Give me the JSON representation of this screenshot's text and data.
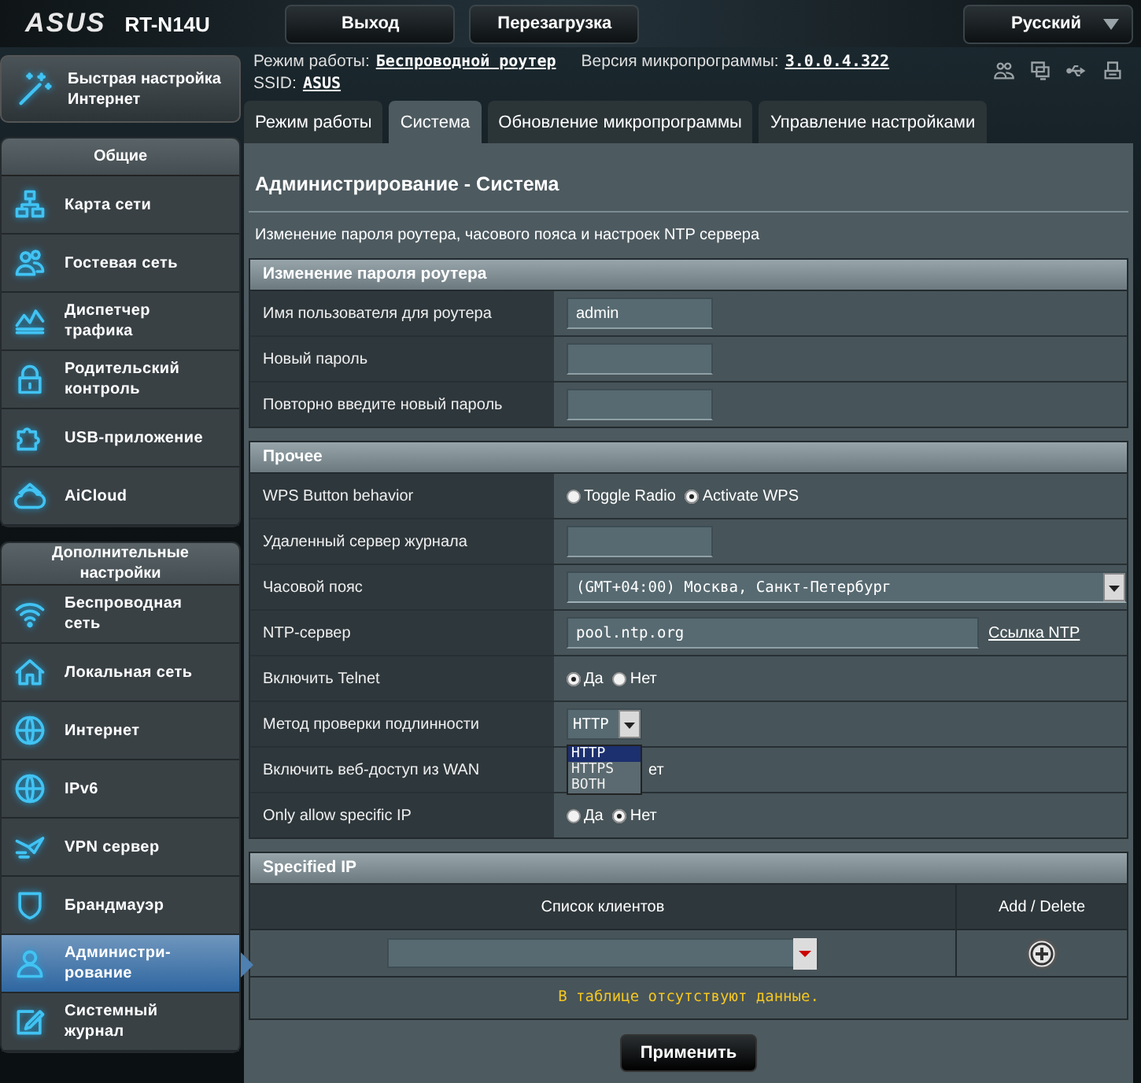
{
  "header": {
    "logo": "ASUS",
    "model": "RT-N14U",
    "buttons": [
      "Выход",
      "Перезагрузка"
    ],
    "language": "Русский"
  },
  "info": {
    "mode_label": "Режим работы:",
    "mode": "Беспроводной роутер",
    "firmware_label": "Версия микропрограммы:",
    "firmware": "3.0.0.4.322",
    "ssid_label": "SSID:",
    "ssid": "ASUS"
  },
  "sidebar": {
    "quick_setup": "Быстрая настройка\nИнтернет",
    "groups": [
      {
        "title": "Общие",
        "items": [
          {
            "label": "Карта сети",
            "selected": false
          },
          {
            "label": "Гостевая сеть",
            "selected": false
          },
          {
            "label": "Диспетчер\nтрафика",
            "selected": false
          },
          {
            "label": "Родительский\nконтроль",
            "selected": false
          },
          {
            "label": "USB-приложение",
            "selected": false
          },
          {
            "label": "AiCloud",
            "selected": false
          }
        ]
      },
      {
        "title": "Дополнительные\nнастройки",
        "items": [
          {
            "label": "Беспроводная\nсеть",
            "selected": false
          },
          {
            "label": "Локальная сеть",
            "selected": false
          },
          {
            "label": "Интернет",
            "selected": false
          },
          {
            "label": "IPv6",
            "selected": false
          },
          {
            "label": "VPN сервер",
            "selected": false
          },
          {
            "label": "Брандмауэр",
            "selected": false
          },
          {
            "label": "Администри-\nрование",
            "selected": true
          },
          {
            "label": "Системный\nжурнал",
            "selected": false
          }
        ]
      }
    ]
  },
  "tabs": [
    {
      "label": "Режим работы",
      "selected": false
    },
    {
      "label": "Система",
      "selected": true
    },
    {
      "label": "Обновление микропрограммы",
      "selected": false
    },
    {
      "label": "Управление настройками",
      "selected": false
    }
  ],
  "page": {
    "title": "Администрирование - Система",
    "description": "Изменение пароля роутера, часового пояса и настроек NTP сервера"
  },
  "sections": [
    {
      "title": "Изменение пароля роутера",
      "rows": [
        {
          "label": "Имя пользователя для роутера",
          "kind": "input",
          "value": "admin"
        },
        {
          "label": "Новый пароль",
          "kind": "input"
        },
        {
          "label": "Повторно введите новый пароль",
          "kind": "input"
        }
      ]
    },
    {
      "title": "Прочее",
      "rows": [
        {
          "label": "WPS Button behavior",
          "kind": "radio",
          "options": [
            {
              "label": "Toggle Radio",
              "selected": false
            },
            {
              "label": "Activate WPS",
              "selected": true
            }
          ]
        },
        {
          "label": "Удаленный сервер журнала",
          "kind": "input"
        },
        {
          "label": "Часовой пояс",
          "kind": "select",
          "value": "(GMT+04:00) Москва, Санкт-Петербург"
        },
        {
          "label": "NTP-сервер",
          "kind": "input_link",
          "value": "pool.ntp.org",
          "link": "Ссылка NTP"
        },
        {
          "label": "Включить Telnet",
          "kind": "radio",
          "options": [
            {
              "label": "Да",
              "selected": true
            },
            {
              "label": "Нет",
              "selected": false
            }
          ]
        },
        {
          "label": "Метод проверки подлинности",
          "kind": "dropdown",
          "value": "HTTP",
          "options": [
            {
              "label": "HTTP",
              "selected": true
            },
            {
              "label": "HTTPS",
              "selected": false
            },
            {
              "label": "BOTH",
              "selected": false
            }
          ]
        },
        {
          "label": "Включить веб-доступ из WAN",
          "kind": "obscured",
          "text": "ет"
        },
        {
          "label": "Only allow specific IP",
          "kind": "radio",
          "options": [
            {
              "label": "Да",
              "selected": false
            },
            {
              "label": "Нет",
              "selected": true
            }
          ]
        }
      ]
    }
  ],
  "specified_ip": {
    "title": "Specified IP",
    "columns": [
      "Список клиентов",
      "Add / Delete"
    ],
    "empty_message": "В таблице отсутствуют данные."
  },
  "apply_button": "Применить"
}
